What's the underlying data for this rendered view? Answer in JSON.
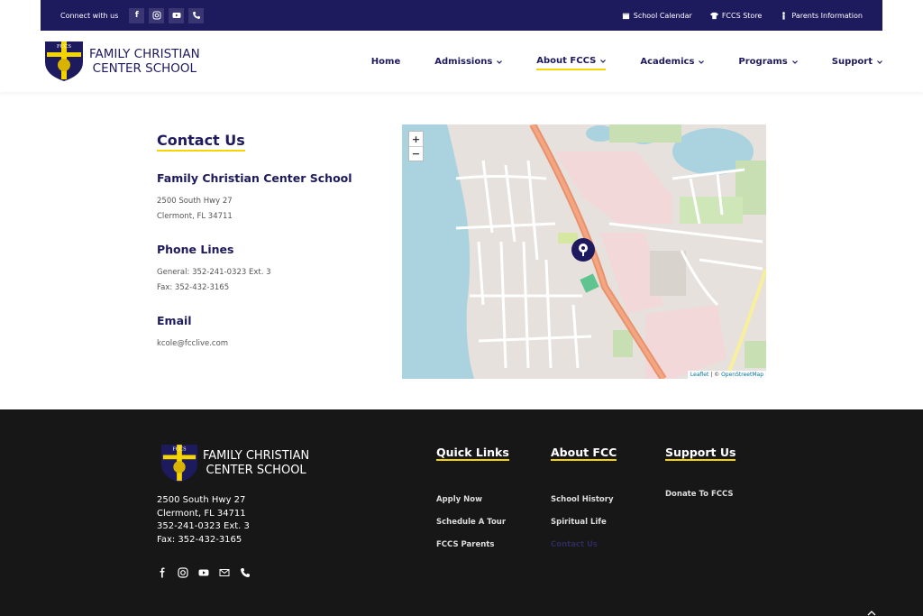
{
  "topbar": {
    "connect": "Connect with us",
    "links": [
      "School Calendar",
      "FCCS Store",
      "Parents Information"
    ]
  },
  "header": {
    "logo_badge": "FCCS",
    "logo_line1": "FAMILY CHRISTIAN",
    "logo_line2": "CENTER SCHOOL",
    "nav": [
      "Home",
      "Admissions",
      "About FCCS",
      "Academics",
      "Programs",
      "Support"
    ],
    "active_nav": "About FCCS"
  },
  "contact": {
    "title": "Contact Us",
    "school_heading": "Family Christian Center School",
    "address_line1": "2500 South Hwy 27",
    "address_line2": "Clermont, FL 34711",
    "phone_heading": "Phone Lines",
    "phone_general": "General: 352-241-0323 Ext. 3",
    "phone_fax": "Fax: 352-432-3165",
    "email_heading": "Email",
    "email": "kcole@fcclive.com"
  },
  "map": {
    "zoom_in": "+",
    "zoom_out": "−",
    "attribution_leaflet": "Leaflet",
    "attribution_sep": " | © ",
    "attribution_osm": "OpenStreetMap"
  },
  "footer": {
    "logo_badge": "FCCS",
    "logo_line1": "FAMILY CHRISTIAN",
    "logo_line2": "CENTER SCHOOL",
    "address": [
      "2500 South Hwy 27",
      "Clermont, FL  34711",
      "352-241-0323 Ext. 3",
      "Fax:  352-432-3165"
    ],
    "quick_links": {
      "title": "Quick Links",
      "items": [
        "Apply Now",
        "Schedule A Tour",
        "FCCS Parents"
      ]
    },
    "about": {
      "title": "About FCC",
      "items": [
        "School History",
        "Spiritual Life",
        "Contact Us"
      ]
    },
    "support": {
      "title": "Support Us",
      "items": [
        "Donate To FCCS"
      ]
    }
  },
  "colors": {
    "navy": "#1e1a5e",
    "accent_yellow": "#f5d500",
    "footer_bg": "#171717"
  }
}
